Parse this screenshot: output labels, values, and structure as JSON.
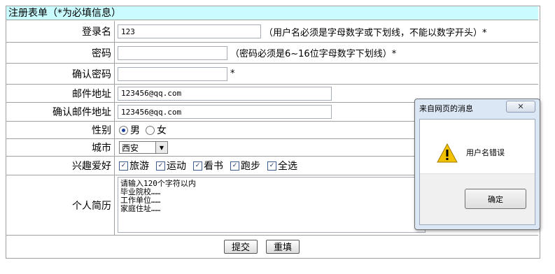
{
  "form": {
    "header": "注册表单（*为必填信息）",
    "username": {
      "label": "登录名",
      "value": "123",
      "hint": "（用户名必须是字母数字或下划线，不能以数字开头）*"
    },
    "password": {
      "label": "密码",
      "value": "",
      "hint": "（密码必须是6~16位字母数字下划线）*"
    },
    "confirm_password": {
      "label": "确认密码",
      "value": "",
      "hint": "*"
    },
    "email": {
      "label": "邮件地址",
      "value": "123456@qq.com"
    },
    "confirm_email": {
      "label": "确认邮件地址",
      "value": "123456@qq.com"
    },
    "gender": {
      "label": "性别",
      "options": [
        "男",
        "女"
      ],
      "selected": "男"
    },
    "city": {
      "label": "城市",
      "value": "西安"
    },
    "hobbies": {
      "label": "兴趣爱好",
      "options": [
        "旅游",
        "运动",
        "看书",
        "跑步",
        "全选"
      ],
      "checked": [
        true,
        true,
        true,
        true,
        true
      ]
    },
    "resume": {
      "label": "个人简历",
      "value": "请输入120个字符以内\n毕业院校……\n工作单位……\n家庭住址……"
    },
    "submit_label": "提交",
    "reset_label": "重填"
  },
  "dialog": {
    "title": "来自网页的消息",
    "message": "用户名错误",
    "ok_label": "确定",
    "close_glyph": "✕",
    "icon": "warning-icon"
  },
  "colors": {
    "header_bg": "#c9fbff",
    "border": "#a0a0a0",
    "warning": "#f2c200"
  }
}
